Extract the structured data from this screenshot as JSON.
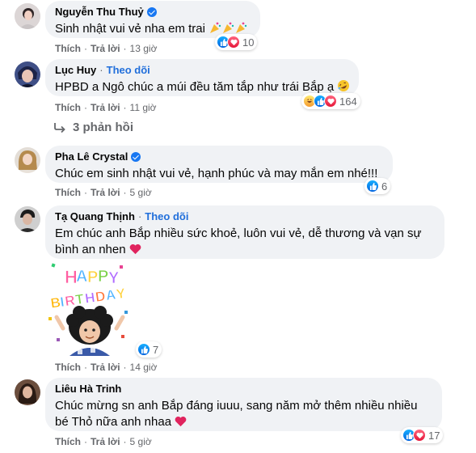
{
  "comments": [
    {
      "name": "Nguyễn Thu Thuỷ",
      "verified": true,
      "text": "Sinh nhật vui vẻ nha em trai",
      "trailing_emoji": "party-popper x3",
      "reactions": [
        "like",
        "love"
      ],
      "reaction_count": "10",
      "like_label": "Thích",
      "reply_label": "Trả lời",
      "time": "13 giờ"
    },
    {
      "name": "Lục Huy",
      "follow_label": "Theo dõi",
      "text": "HPBD a Ngô chúc a múi đều tăm tắp như trái Bắp ạ",
      "trailing_emoji": "rofl",
      "reactions": [
        "haha",
        "like",
        "love"
      ],
      "reaction_count": "164",
      "like_label": "Thích",
      "reply_label": "Trả lời",
      "time": "11 giờ",
      "replies_label": "3 phản hồi"
    },
    {
      "name": "Pha Lê Crystal",
      "verified": true,
      "text": "Chúc em sinh nhật vui vẻ, hạnh phúc và may mắn em nhé!!!",
      "reactions": [
        "like"
      ],
      "reaction_count": "6",
      "like_label": "Thích",
      "reply_label": "Trả lời",
      "time": "5 giờ"
    },
    {
      "name": "Tạ Quang Thịnh",
      "follow_label": "Theo dõi",
      "text_line1": "Em chúc anh Bắp nhiều sức khoẻ, luôn vui vẻ, dễ thương và vạn sự",
      "text_line2": "bình an nhen",
      "sticker_text": "HAPPY BIRTHDAY",
      "reactions": [
        "like"
      ],
      "reaction_count": "7",
      "like_label": "Thích",
      "reply_label": "Trả lời",
      "time": "14 giờ"
    },
    {
      "name": "Liêu Hà Trinh",
      "text_line1": "Chúc mừng sn anh Bắp đáng iuuu, sang năm mở thêm nhiều nhiều",
      "text_line2": "bé Thỏ nữa anh nhaa",
      "reactions": [
        "like",
        "love"
      ],
      "reaction_count": "17",
      "like_label": "Thích",
      "reply_label": "Trả lời",
      "time": "5 giờ"
    }
  ],
  "colors": {
    "bubble": "#f0f2f5",
    "meta": "#65676b",
    "link": "#216fdb",
    "like": "#1877f2",
    "love": "#e61739"
  }
}
